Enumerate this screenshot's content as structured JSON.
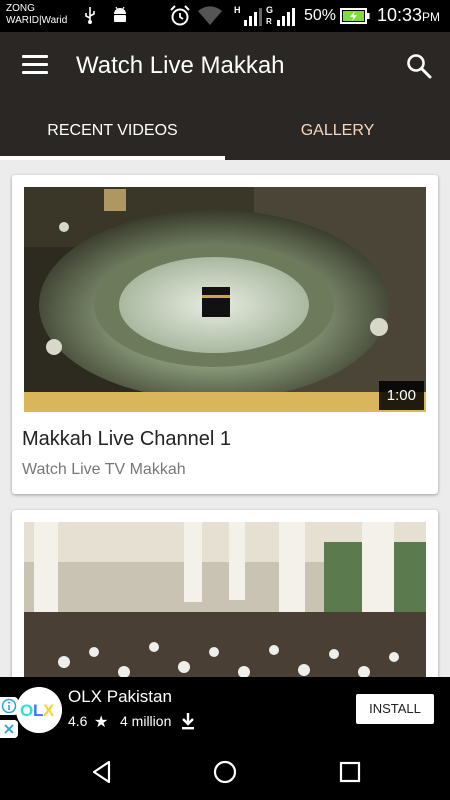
{
  "status_bar": {
    "carrier_line1": "ZONG",
    "carrier_line2": "WARID|Warid",
    "battery": "50%",
    "time": "10:33",
    "time_suffix": "PM"
  },
  "app_bar": {
    "title": "Watch Live Makkah"
  },
  "tabs": [
    {
      "label": "RECENT VIDEOS",
      "active": true
    },
    {
      "label": "GALLERY",
      "active": false
    }
  ],
  "videos": [
    {
      "title": "Makkah Live Channel 1",
      "subtitle": "Watch Live TV Makkah",
      "duration": "1:00"
    },
    {
      "title": "",
      "subtitle": "",
      "duration": ""
    }
  ],
  "ad": {
    "app_name": "OLX Pakistan",
    "rating": "4.6",
    "installs": "4 million",
    "install_label": "INSTALL"
  },
  "colors": {
    "app_bar": "#2b2725",
    "gallery_tab": "#f6d6bf",
    "content_bg": "#ececec"
  }
}
